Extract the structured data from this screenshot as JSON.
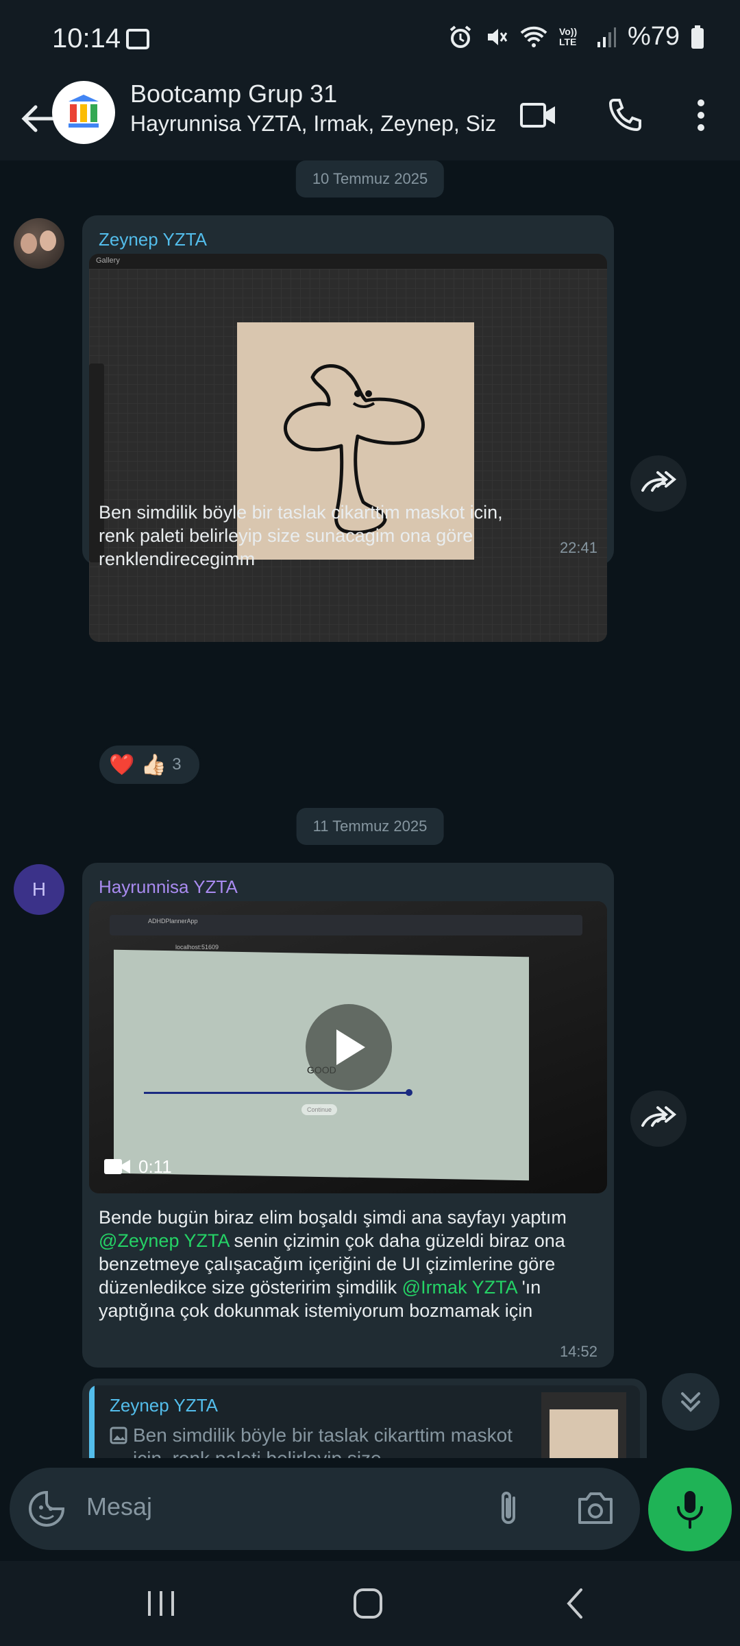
{
  "status": {
    "time": "10:14",
    "battery": "%79",
    "network_label": "Vo)) LTE"
  },
  "header": {
    "title": "Bootcamp Grup 31",
    "subtitle": "Hayrunnisa YZTA, Irmak, Zeynep, Siz"
  },
  "dates": {
    "first": "10 Temmuz 2025",
    "second": "11 Temmuz 2025"
  },
  "messages": [
    {
      "sender": "Zeynep YZTA",
      "sender_color": "#53bdeb",
      "text": "Ben simdilik böyle bir taslak cikarttim maskot icin, renk paleti belirleyip size sunacagim ona göre renklendirecegimm",
      "time": "22:41",
      "reactions": "❤️ 👍🏻",
      "reaction_count": "3",
      "image": {
        "gallery": "Gallery"
      }
    },
    {
      "sender": "Hayrunnisa YZTA",
      "sender_color": "#a98bf0",
      "avatar_letter": "H",
      "video_duration": "0:11",
      "video": {
        "app_tab": "ADHDPlannerApp",
        "url": "localhost:51609",
        "face_label": "GOOD",
        "button_label": "Continue"
      },
      "text_parts": {
        "p1": "Bende bugün biraz elim boşaldı şimdi ana sayfayı yaptım ",
        "m1": "@Zeynep YZTA",
        "p2": " senin çizimin çok daha güzeldi biraz ona benzetmeye çalışacağım içeriğini de UI çizimlerine göre düzenledikce size gösteririm şimdilik ",
        "m2": "@Irmak YZTA",
        "p3": " 'ın yaptığına çok dokunmak istemiyorum bozmamak için"
      },
      "time": "14:52"
    },
    {
      "reply_sender": "Zeynep YZTA",
      "reply_text": "Ben simdilik böyle bir taslak cikarttim maskot icin, renk paleti belirleyip size"
    }
  ],
  "composer": {
    "placeholder": "Mesaj"
  },
  "colors": {
    "accent": "#25d366",
    "bg": "#0b141a",
    "bubble": "#202c33"
  }
}
